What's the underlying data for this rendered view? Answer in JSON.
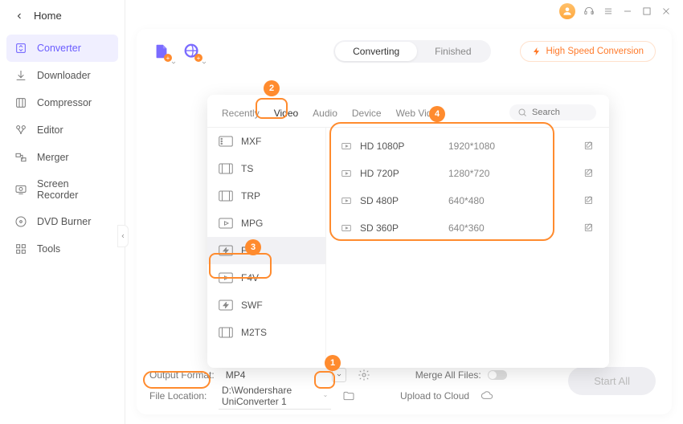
{
  "home_label": "Home",
  "sidebar": [
    {
      "label": "Converter"
    },
    {
      "label": "Downloader"
    },
    {
      "label": "Compressor"
    },
    {
      "label": "Editor"
    },
    {
      "label": "Merger"
    },
    {
      "label": "Screen Recorder"
    },
    {
      "label": "DVD Burner"
    },
    {
      "label": "Tools"
    }
  ],
  "pill_tabs": {
    "converting": "Converting",
    "finished": "Finished"
  },
  "speed_label": "High Speed Conversion",
  "footer": {
    "output_format_label": "Output Format:",
    "output_format_value": "MP4",
    "file_location_label": "File Location:",
    "file_location_value": "D:\\Wondershare UniConverter 1",
    "merge_label": "Merge All Files:",
    "upload_label": "Upload to Cloud"
  },
  "start_label": "Start All",
  "picker_tabs": [
    "Recently",
    "Video",
    "Audio",
    "Device",
    "Web Video"
  ],
  "search_placeholder": "Search",
  "formats": [
    {
      "name": "MXF"
    },
    {
      "name": "TS"
    },
    {
      "name": "TRP"
    },
    {
      "name": "MPG"
    },
    {
      "name": "FLV"
    },
    {
      "name": "F4V"
    },
    {
      "name": "SWF"
    },
    {
      "name": "M2TS"
    }
  ],
  "resolutions": [
    {
      "name": "HD 1080P",
      "dim": "1920*1080"
    },
    {
      "name": "HD 720P",
      "dim": "1280*720"
    },
    {
      "name": "SD 480P",
      "dim": "640*480"
    },
    {
      "name": "SD 360P",
      "dim": "640*360"
    }
  ],
  "annotations": [
    "1",
    "2",
    "3",
    "4"
  ]
}
